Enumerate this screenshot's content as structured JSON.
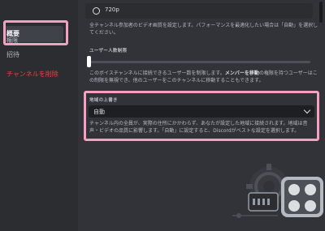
{
  "sidebar": {
    "items": [
      {
        "label": "概要"
      },
      {
        "label": "権限"
      },
      {
        "label": "招待"
      },
      {
        "label": "チャンネルを削除"
      }
    ]
  },
  "video_quality": {
    "option_label": "720p",
    "description": "全チャンネル参加者のビデオ画質を設定します。パフォーマンスを最適化したい場合は「自動」を選択してください。"
  },
  "user_limit": {
    "title": "ユーザー人数制限",
    "value_fraction": 0,
    "description_pre": "このボイスチャンネルに接続できるユーザー数を制限します。",
    "description_bold": "メンバーを移動",
    "description_post": "の権限を持つユーザーはこの制限を無視でき、他のユーザーをこのチャンネルに移動することもできます。"
  },
  "region_override": {
    "title": "地域の上書き",
    "selected": "自動",
    "description": "チャンネル内の全員が、実際の住所にかかわらず、あなたが設定した地域に接続されます。地域は音声・ビデオの品質に影響します。「自動」に設定すると、Discordがベストな設定を選択します。"
  },
  "colors": {
    "highlight": "#f4a0bf",
    "danger": "#f23f43",
    "background": "#313338",
    "sidebar": "#2b2d31"
  }
}
